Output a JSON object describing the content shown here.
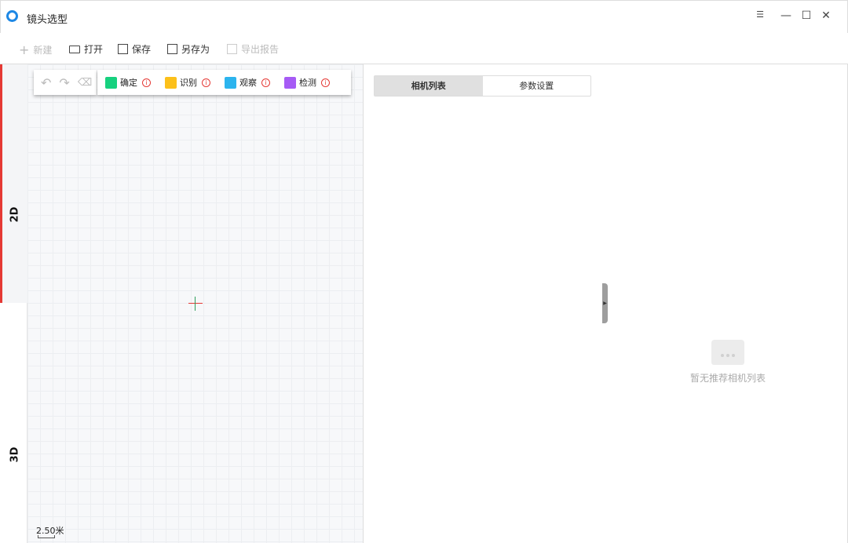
{
  "window": {
    "title": "镜头选型",
    "menu_icon": "☰",
    "minimize": "—",
    "maximize": "☐",
    "close": "✕"
  },
  "toolbar": {
    "new": "新建",
    "open": "打开",
    "save": "保存",
    "save_as": "另存为",
    "export": "导出报告"
  },
  "view_tabs": {
    "tab_2d": "2D",
    "tab_3d": "3D"
  },
  "legend": [
    {
      "label": "确定",
      "color": "#17d17f"
    },
    {
      "label": "识别",
      "color": "#fcc01a"
    },
    {
      "label": "观察",
      "color": "#2cb4ee"
    },
    {
      "label": "检测",
      "color": "#a65bf5"
    }
  ],
  "info_glyph": "i",
  "scale": "2.50米",
  "right_tabs": {
    "camera_list": "相机列表",
    "params": "参数设置"
  },
  "empty_text": "暂无推荐相机列表"
}
